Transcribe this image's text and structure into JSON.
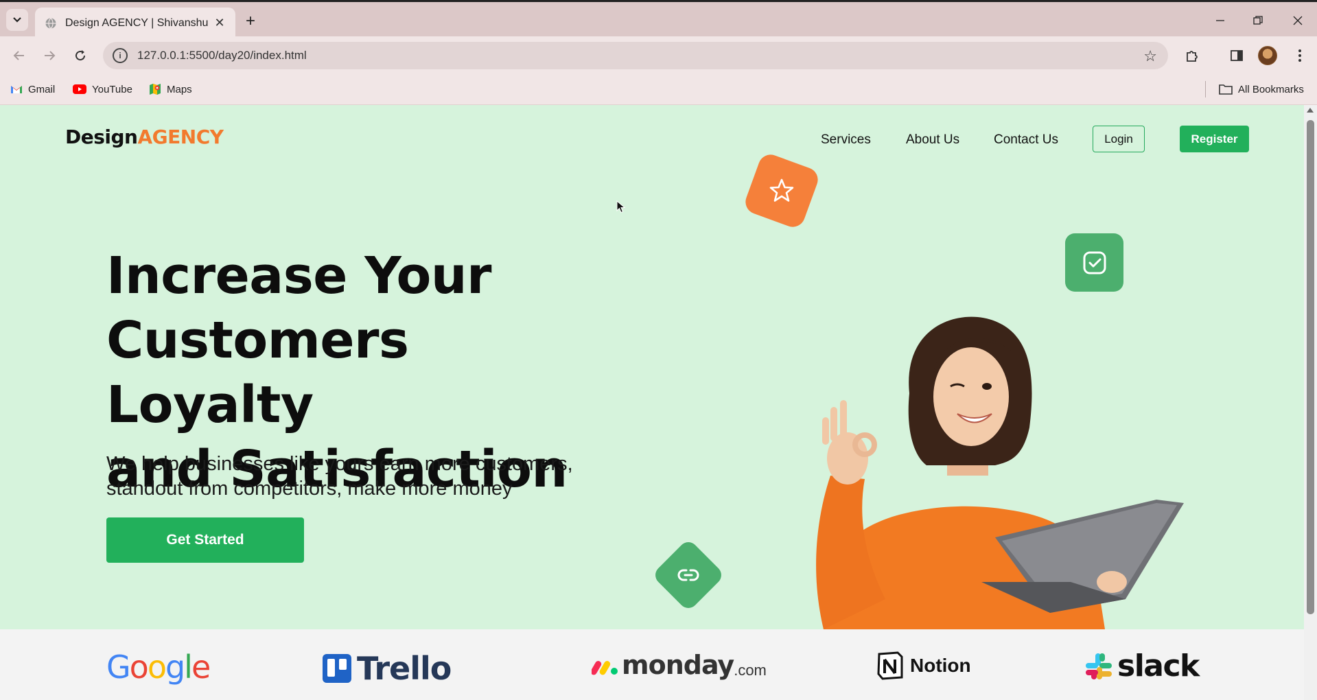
{
  "browser": {
    "tab_title": "Design AGENCY | Shivanshu",
    "url": "127.0.0.1:5500/day20/index.html",
    "bookmarks": [
      {
        "label": "Gmail",
        "icon": "gmail-icon"
      },
      {
        "label": "YouTube",
        "icon": "youtube-icon"
      },
      {
        "label": "Maps",
        "icon": "maps-icon"
      }
    ],
    "all_bookmarks_label": "All Bookmarks"
  },
  "site": {
    "logo_part1": "Design",
    "logo_part2": "AGENCY",
    "nav": [
      {
        "label": "Services"
      },
      {
        "label": "About Us"
      },
      {
        "label": "Contact Us"
      }
    ],
    "login_label": "Login",
    "register_label": "Register"
  },
  "hero": {
    "headline_line1": "Increase Your",
    "headline_line2": "Customers Loyalty",
    "headline_line3": "and Satisfaction",
    "subline_line1": "We help businesses like yours earn more customers,",
    "subline_line2": "standout from competitors, make more money",
    "cta_label": "Get Started"
  },
  "brands": [
    {
      "label": "Google"
    },
    {
      "label": "Trello"
    },
    {
      "label": "monday",
      "suffix": ".com"
    },
    {
      "label": "Notion"
    },
    {
      "label": "slack"
    }
  ],
  "colors": {
    "hero_bg": "#d6f3dc",
    "accent_green": "#22b05b",
    "accent_orange": "#f27a2e"
  }
}
